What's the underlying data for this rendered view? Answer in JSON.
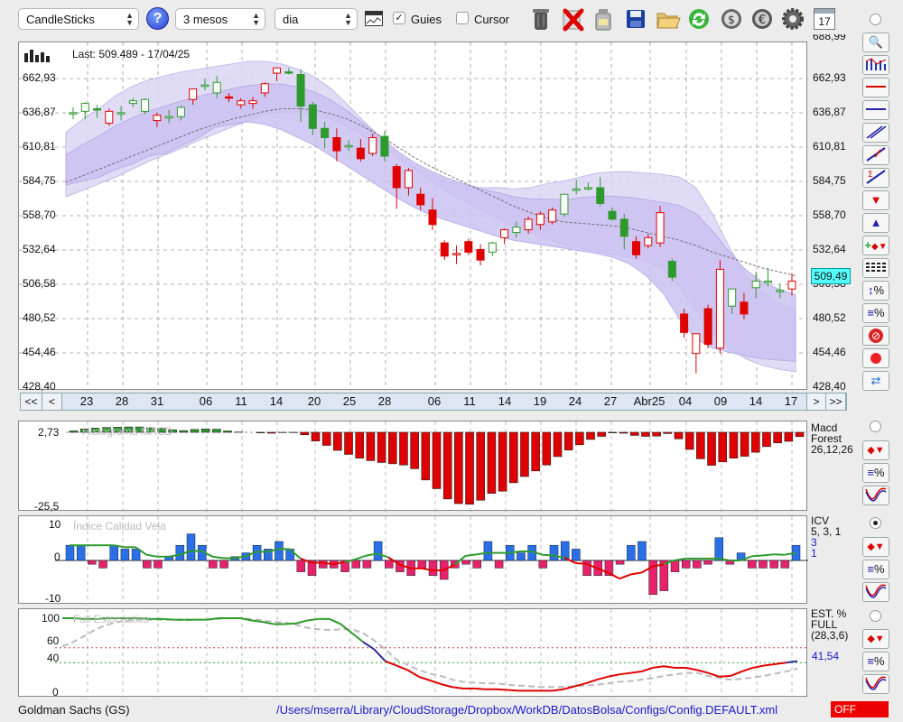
{
  "toolbar": {
    "chart_type": "CandleSticks",
    "help_icon": "question-icon",
    "period": "3 mesos",
    "interval": "dia",
    "guides_label": "Guies",
    "guides_checked": true,
    "cursor_label": "Cursor",
    "cursor_checked": false,
    "calendar_day": "17"
  },
  "main_chart": {
    "last_label": "Last: 509.489 - 17/04/25",
    "y_ticks": [
      "662,93",
      "636,87",
      "610,81",
      "584,75",
      "558,70",
      "532,64",
      "506,58",
      "480,52",
      "454,46",
      "428,40"
    ],
    "y_top_partial": "688,99",
    "current_price": "509,49",
    "nav_prev_prev": "<<",
    "nav_prev": "<",
    "nav_next": ">",
    "nav_next_next": ">>",
    "x_labels": [
      "23",
      "28",
      "31",
      "06",
      "11",
      "14",
      "20",
      "25",
      "28",
      "06",
      "11",
      "14",
      "19",
      "24",
      "27",
      "Abr25",
      "04",
      "09",
      "14",
      "17"
    ]
  },
  "macd_panel": {
    "watermark": "Histograma MACD",
    "y_ticks": [
      "2,73",
      "-25,5"
    ],
    "title_lines": [
      "Macd",
      "Forest",
      "26,12,26"
    ]
  },
  "icv_panel": {
    "watermark": "Índice Calidad Vela",
    "y_ticks": [
      "10",
      "0",
      "-10"
    ],
    "title_lines": [
      "ICV",
      "5, 3, 1"
    ],
    "values": [
      "3",
      "1"
    ]
  },
  "stoch_panel": {
    "watermark": "Full Estocástico",
    "y_ticks": [
      "100",
      "60",
      "40",
      "0"
    ],
    "title_lines": [
      "EST. %",
      "FULL",
      "(28,3,6)"
    ],
    "value": "41,54"
  },
  "status": {
    "symbol": "Goldman Sachs (GS)",
    "config_path": "/Users/mserra/Library/CloudStorage/Dropbox/WorkDB/DatosBolsa/Configs/Config.DEFAULT.xml",
    "off_label": "OFF"
  },
  "colors": {
    "up": "#2e9a2e",
    "down": "#e00000",
    "band": "#cfc8f0",
    "accent": "#1a1acc"
  },
  "chart_data": [
    {
      "type": "candlestick",
      "title": "Goldman Sachs (GS)",
      "ylim": [
        428.4,
        688.99
      ],
      "x_labels": [
        "23",
        "28",
        "31",
        "06",
        "11",
        "14",
        "20",
        "25",
        "28",
        "06",
        "11",
        "14",
        "19",
        "24",
        "27",
        "Abr25",
        "04",
        "09",
        "14",
        "17"
      ],
      "candles": [
        {
          "o": 637,
          "h": 641,
          "l": 632,
          "c": 637,
          "up": true
        },
        {
          "o": 638,
          "h": 645,
          "l": 632,
          "c": 644,
          "up": true
        },
        {
          "o": 640,
          "h": 643,
          "l": 633,
          "c": 639,
          "up": true
        },
        {
          "o": 629,
          "h": 640,
          "l": 627,
          "c": 638,
          "up": false
        },
        {
          "o": 636,
          "h": 642,
          "l": 631,
          "c": 637,
          "up": true
        },
        {
          "o": 644,
          "h": 648,
          "l": 641,
          "c": 646,
          "up": true
        },
        {
          "o": 638,
          "h": 648,
          "l": 636,
          "c": 647,
          "up": true
        },
        {
          "o": 631,
          "h": 637,
          "l": 626,
          "c": 635,
          "up": false
        },
        {
          "o": 633,
          "h": 639,
          "l": 629,
          "c": 634,
          "up": true
        },
        {
          "o": 634,
          "h": 642,
          "l": 631,
          "c": 641,
          "up": true
        },
        {
          "o": 647,
          "h": 652,
          "l": 643,
          "c": 655,
          "up": false
        },
        {
          "o": 658,
          "h": 663,
          "l": 654,
          "c": 658,
          "up": true
        },
        {
          "o": 652,
          "h": 665,
          "l": 648,
          "c": 660,
          "up": true
        },
        {
          "o": 649,
          "h": 652,
          "l": 645,
          "c": 648,
          "up": false
        },
        {
          "o": 643,
          "h": 648,
          "l": 640,
          "c": 646,
          "up": false
        },
        {
          "o": 644,
          "h": 649,
          "l": 640,
          "c": 646,
          "up": false
        },
        {
          "o": 652,
          "h": 660,
          "l": 649,
          "c": 659,
          "up": false
        },
        {
          "o": 667,
          "h": 671,
          "l": 661,
          "c": 671,
          "up": false
        },
        {
          "o": 668,
          "h": 671,
          "l": 666,
          "c": 667,
          "up": true
        },
        {
          "o": 666,
          "h": 670,
          "l": 630,
          "c": 642,
          "up": true
        },
        {
          "o": 643,
          "h": 645,
          "l": 620,
          "c": 625,
          "up": true
        },
        {
          "o": 625,
          "h": 630,
          "l": 610,
          "c": 618,
          "up": true
        },
        {
          "o": 618,
          "h": 625,
          "l": 600,
          "c": 608,
          "up": false
        },
        {
          "o": 612,
          "h": 616,
          "l": 608,
          "c": 612,
          "up": true
        },
        {
          "o": 610,
          "h": 617,
          "l": 600,
          "c": 602,
          "up": false
        },
        {
          "o": 606,
          "h": 621,
          "l": 604,
          "c": 618,
          "up": false
        },
        {
          "o": 619,
          "h": 623,
          "l": 600,
          "c": 604,
          "up": true
        },
        {
          "o": 596,
          "h": 598,
          "l": 564,
          "c": 580,
          "up": false
        },
        {
          "o": 580,
          "h": 595,
          "l": 574,
          "c": 593,
          "up": false
        },
        {
          "o": 575,
          "h": 580,
          "l": 563,
          "c": 567,
          "up": false
        },
        {
          "o": 563,
          "h": 572,
          "l": 548,
          "c": 552,
          "up": false
        },
        {
          "o": 538,
          "h": 540,
          "l": 525,
          "c": 528,
          "up": false
        },
        {
          "o": 530,
          "h": 536,
          "l": 522,
          "c": 530,
          "up": false
        },
        {
          "o": 539,
          "h": 541,
          "l": 529,
          "c": 531,
          "up": false
        },
        {
          "o": 533,
          "h": 537,
          "l": 521,
          "c": 525,
          "up": false
        },
        {
          "o": 531,
          "h": 539,
          "l": 528,
          "c": 538,
          "up": true
        },
        {
          "o": 542,
          "h": 549,
          "l": 537,
          "c": 548,
          "up": false
        },
        {
          "o": 546,
          "h": 554,
          "l": 542,
          "c": 550,
          "up": true
        },
        {
          "o": 548,
          "h": 558,
          "l": 545,
          "c": 556,
          "up": false
        },
        {
          "o": 552,
          "h": 562,
          "l": 548,
          "c": 560,
          "up": false
        },
        {
          "o": 554,
          "h": 565,
          "l": 552,
          "c": 563,
          "up": false
        },
        {
          "o": 560,
          "h": 575,
          "l": 558,
          "c": 575,
          "up": true
        },
        {
          "o": 578,
          "h": 586,
          "l": 575,
          "c": 579,
          "up": true
        },
        {
          "o": 580,
          "h": 584,
          "l": 578,
          "c": 580,
          "up": true
        },
        {
          "o": 580,
          "h": 588,
          "l": 566,
          "c": 568,
          "up": true
        },
        {
          "o": 562,
          "h": 565,
          "l": 555,
          "c": 556,
          "up": true
        },
        {
          "o": 556,
          "h": 560,
          "l": 533,
          "c": 543,
          "up": true
        },
        {
          "o": 539,
          "h": 543,
          "l": 526,
          "c": 529,
          "up": false
        },
        {
          "o": 536,
          "h": 545,
          "l": 534,
          "c": 542,
          "up": false
        },
        {
          "o": 538,
          "h": 566,
          "l": 535,
          "c": 561,
          "up": false
        },
        {
          "o": 524,
          "h": 526,
          "l": 509,
          "c": 512,
          "up": true
        },
        {
          "o": 484,
          "h": 488,
          "l": 466,
          "c": 470,
          "up": false
        },
        {
          "o": 454,
          "h": 466,
          "l": 439,
          "c": 469,
          "up": false
        },
        {
          "o": 488,
          "h": 491,
          "l": 458,
          "c": 461,
          "up": false
        },
        {
          "o": 458,
          "h": 525,
          "l": 454,
          "c": 518,
          "up": false
        },
        {
          "o": 490,
          "h": 503,
          "l": 484,
          "c": 503,
          "up": true
        },
        {
          "o": 493,
          "h": 500,
          "l": 480,
          "c": 484,
          "up": false
        },
        {
          "o": 504,
          "h": 516,
          "l": 496,
          "c": 509,
          "up": true
        },
        {
          "o": 509,
          "h": 519,
          "l": 505,
          "c": 509,
          "up": true
        },
        {
          "o": 502,
          "h": 507,
          "l": 496,
          "c": 502,
          "up": true
        },
        {
          "o": 503,
          "h": 515,
          "l": 498,
          "c": 509,
          "up": false
        }
      ],
      "band_upper": [
        622,
        632,
        640,
        650,
        657,
        662,
        665,
        668,
        670,
        672,
        674,
        676,
        676,
        674,
        670,
        664,
        655,
        643,
        630,
        618,
        605,
        596,
        590,
        585,
        582,
        580,
        580,
        579,
        580,
        583,
        585,
        588,
        591,
        592,
        592,
        591,
        590,
        588,
        580,
        560,
        535,
        513,
        500,
        492,
        487
      ],
      "band_mid": [
        584,
        589,
        594,
        599,
        604,
        609,
        614,
        619,
        624,
        628,
        632,
        635,
        638,
        640,
        640,
        639,
        636,
        632,
        626,
        619,
        611,
        603,
        596,
        590,
        584,
        578,
        572,
        566,
        561,
        557,
        554,
        553,
        552,
        551,
        549,
        546,
        543,
        540,
        536,
        531,
        527,
        523,
        519,
        516,
        513
      ],
      "band_lower": [
        573,
        578,
        583,
        588,
        594,
        600,
        605,
        610,
        616,
        621,
        626,
        631,
        636,
        637,
        638,
        635,
        632,
        626,
        619,
        611,
        603,
        594,
        585,
        577,
        570,
        563,
        557,
        551,
        546,
        541,
        537,
        534,
        531,
        529,
        527,
        524,
        518,
        505,
        487,
        470,
        458,
        450,
        445,
        442,
        440
      ],
      "band_inner_lower": [
        582,
        585,
        588,
        594,
        598,
        604,
        606,
        612,
        618,
        626,
        628,
        630,
        628,
        624,
        618,
        612,
        604,
        596,
        588,
        580,
        572,
        565,
        559,
        555,
        551,
        547,
        543,
        540,
        538,
        536,
        534,
        532,
        530,
        527,
        522,
        513,
        500,
        480,
        465,
        458,
        455,
        452,
        450,
        449,
        448
      ]
    },
    {
      "type": "bar",
      "title": "Histograma MACD",
      "ylim": [
        -25.5,
        2.73
      ],
      "values": [
        0.5,
        1.2,
        1.5,
        1.7,
        1.8,
        1.9,
        1.9,
        1.6,
        1.4,
        0.9,
        0.6,
        1.0,
        1.2,
        1.1,
        0.5,
        0.1,
        0.0,
        -0.2,
        -0.3,
        -0.1,
        -0.1,
        -0.8,
        -2.8,
        -4.2,
        -5.8,
        -7.1,
        -8.3,
        -9.1,
        -9.7,
        -10.1,
        -10.5,
        -11.7,
        -15.3,
        -18.1,
        -21.4,
        -22.9,
        -23.1,
        -21.8,
        -19.6,
        -18.9,
        -16.2,
        -14.2,
        -12.4,
        -10.5,
        -7.8,
        -5.7,
        -4.0,
        -2.3,
        -1.3,
        -0.2,
        -0.3,
        -1.0,
        -1.3,
        -1.2,
        -0.4,
        -2.1,
        -5.5,
        -8.5,
        -10.6,
        -9.5,
        -8.3,
        -7.7,
        -6.4,
        -4.6,
        -3.4,
        -2.9,
        -1.4
      ]
    },
    {
      "type": "bar",
      "title": "Índice Calidad Vela",
      "ylim": [
        -10,
        10
      ],
      "values": [
        4,
        4,
        -1,
        -2,
        4,
        3,
        3,
        -2,
        -2,
        1,
        4,
        7,
        4,
        -2,
        -2,
        1,
        2,
        4,
        3,
        5,
        3,
        -3,
        -4,
        -2,
        -2,
        -3,
        -2,
        -2,
        5,
        -2,
        -3,
        -4,
        -2,
        -4,
        -5,
        -2,
        -1,
        -2,
        5,
        -2,
        4,
        2,
        4,
        -2,
        4,
        5,
        3,
        -4,
        -4,
        -4,
        -1,
        4,
        5,
        -9,
        -8,
        -3,
        -2,
        -2,
        -1,
        6,
        -1,
        2,
        -2,
        -2,
        -2,
        -2,
        4
      ],
      "ma": [
        4.0,
        4.0,
        4.0,
        4.0,
        4.0,
        3.5,
        3.5,
        1.5,
        1.0,
        1.0,
        1.5,
        2.5,
        2.5,
        1.0,
        0.6,
        0.6,
        1.1,
        2.3,
        2.3,
        3.0,
        3.0,
        0.5,
        -0.6,
        -0.6,
        -1.0,
        -0.4,
        0.3,
        1.3,
        1.8,
        0.8,
        -1.1,
        -2.1,
        -2.1,
        -2.6,
        -2.6,
        -1.1,
        1.2,
        1.6,
        2.0,
        2.0,
        2.0,
        2.4,
        2.4,
        1.5,
        1.3,
        0.7,
        -0.7,
        -0.9,
        -2.1,
        -3.3,
        -4.8,
        -3.7,
        -3.2,
        -1.6,
        -1.0,
        0.0,
        0.5,
        0.5,
        0.5,
        0.5,
        0.0,
        0.0,
        1.1,
        1.3,
        1.6,
        1.5,
        2.0
      ]
    },
    {
      "type": "line",
      "title": "Full Estocástico",
      "ylim": [
        0,
        100
      ],
      "x": [
        0,
        66
      ],
      "series": [
        {
          "name": "%K",
          "values": [
            100,
            100,
            99,
            99,
            100,
            100,
            100,
            100,
            99,
            99,
            98,
            98,
            98,
            98,
            100,
            100,
            100,
            97,
            95,
            92,
            92,
            93,
            97,
            99,
            99,
            92,
            80,
            68,
            58,
            42,
            36,
            30,
            21,
            16,
            11,
            7,
            5,
            5,
            4,
            4,
            3,
            2,
            2,
            2,
            2,
            4,
            8,
            12,
            17,
            21,
            24,
            26,
            28,
            33,
            35,
            33,
            33,
            30,
            26,
            21,
            22,
            28,
            33,
            36,
            38,
            40,
            42
          ]
        },
        {
          "name": "%D",
          "values": [
            62,
            68,
            76,
            85,
            91,
            95,
            97,
            98,
            98,
            98,
            98,
            97,
            98,
            98,
            99,
            100,
            100,
            99,
            97,
            95,
            94,
            91,
            87,
            85,
            84,
            85,
            85,
            80,
            70,
            58,
            44,
            37,
            30,
            25,
            22,
            17,
            14,
            13,
            12,
            12,
            10,
            9,
            8,
            7,
            7,
            7,
            8,
            9,
            10,
            12,
            14,
            15,
            17,
            19,
            22,
            24,
            26,
            26,
            22,
            19,
            17,
            18,
            20,
            22,
            25,
            28,
            32
          ]
        }
      ],
      "hlines": [
        60,
        40
      ]
    }
  ]
}
